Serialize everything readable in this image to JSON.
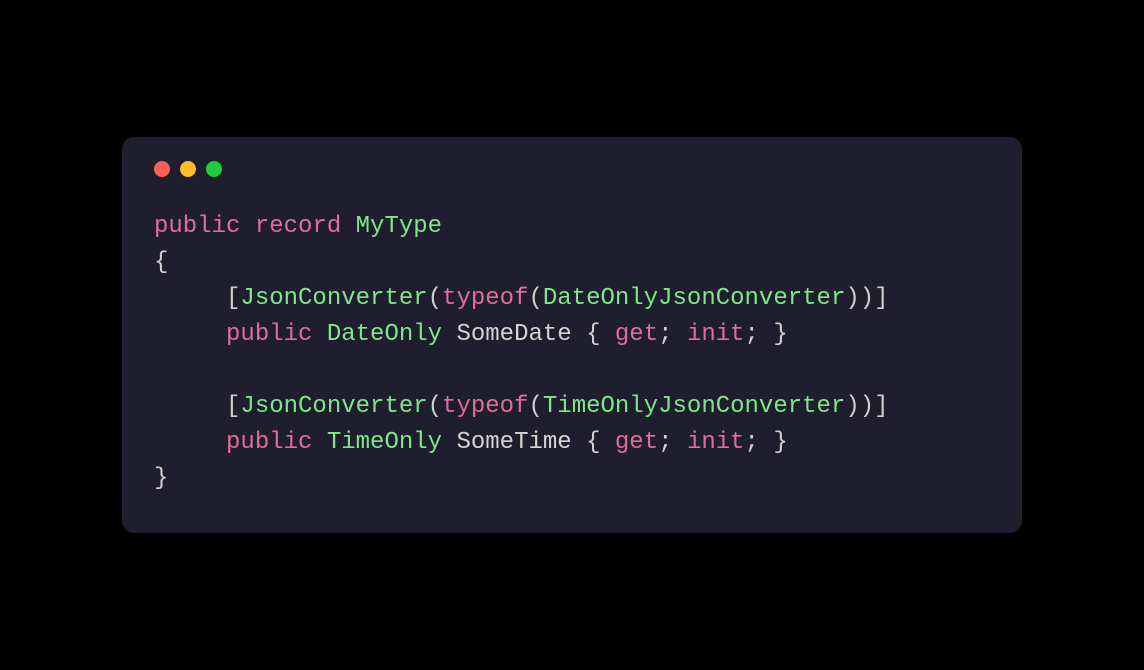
{
  "colors": {
    "background": "#000000",
    "windowBg": "#1e1e2e",
    "keyword": "#e06c9c",
    "type": "#7ee787",
    "default": "#d4d4d4",
    "trafficRed": "#ff5f56",
    "trafficYellow": "#ffbd2e",
    "trafficGreen": "#27c93f"
  },
  "code": {
    "line1": {
      "kw1": "public",
      "kw2": "record",
      "typeName": "MyType"
    },
    "line2": {
      "brace": "{"
    },
    "line3": {
      "indent": "     ",
      "lbracket": "[",
      "attrName": "JsonConverter",
      "lparen": "(",
      "typeof": "typeof",
      "lparen2": "(",
      "converterType": "DateOnlyJsonConverter",
      "rparen2": ")",
      "rparen": ")",
      "rbracket": "]"
    },
    "line4": {
      "indent": "     ",
      "kw1": "public",
      "propType": "DateOnly",
      "propName": "SomeDate",
      "lbrace": "{",
      "get": "get",
      "semi1": ";",
      "init": "init",
      "semi2": ";",
      "rbrace": "}"
    },
    "line5": {
      "blank": ""
    },
    "line6": {
      "indent": "     ",
      "lbracket": "[",
      "attrName": "JsonConverter",
      "lparen": "(",
      "typeof": "typeof",
      "lparen2": "(",
      "converterType": "TimeOnlyJsonConverter",
      "rparen2": ")",
      "rparen": ")",
      "rbracket": "]"
    },
    "line7": {
      "indent": "     ",
      "kw1": "public",
      "propType": "TimeOnly",
      "propName": "SomeTime",
      "lbrace": "{",
      "get": "get",
      "semi1": ";",
      "init": "init",
      "semi2": ";",
      "rbrace": "}"
    },
    "line8": {
      "brace": "}"
    }
  }
}
